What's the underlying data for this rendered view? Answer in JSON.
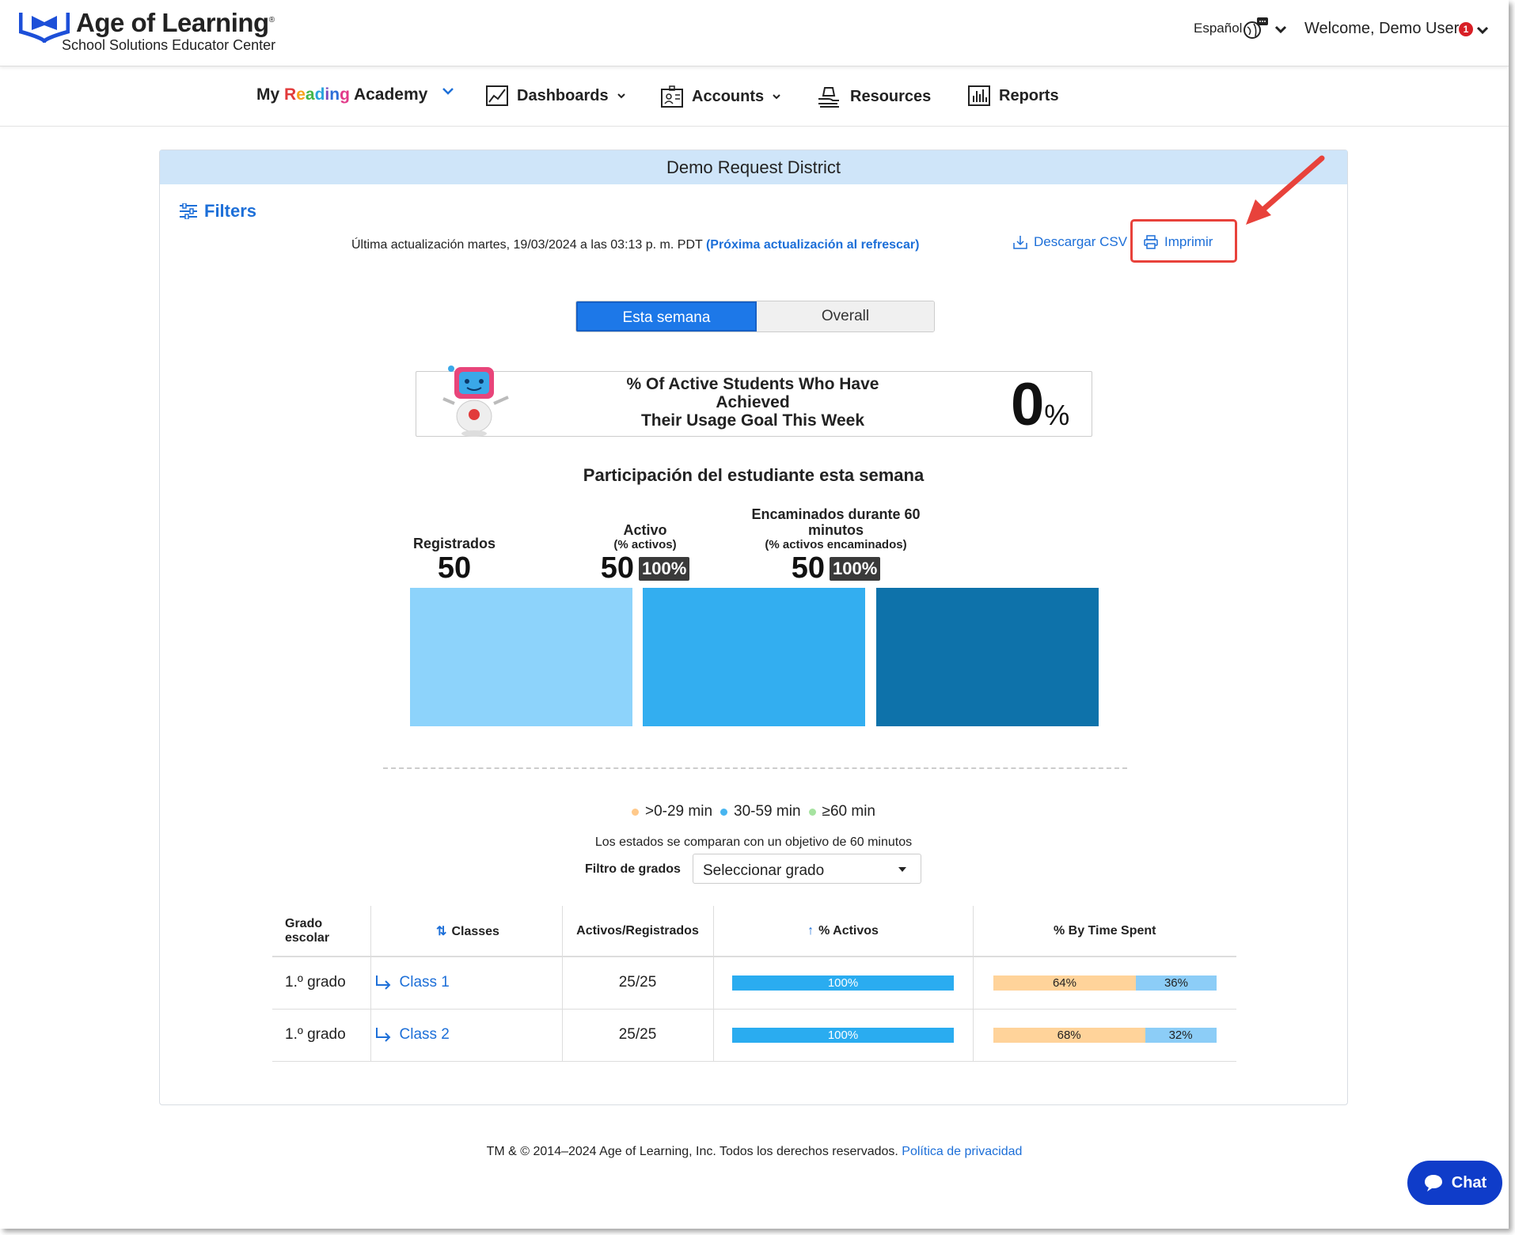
{
  "header": {
    "brand": "Age of Learning",
    "subbrand": "School Solutions Educator Center",
    "language": "Español",
    "welcome": "Welcome, Demo User",
    "notification_count": "1"
  },
  "nav": {
    "product": [
      "My ",
      "R",
      "e",
      "a",
      "d",
      "i",
      "n",
      "g",
      " Academy"
    ],
    "items": [
      {
        "label": "Dashboards",
        "icon": "chart-icon"
      },
      {
        "label": "Accounts",
        "icon": "id-card-icon"
      },
      {
        "label": "Resources",
        "icon": "hand-book-icon"
      },
      {
        "label": "Reports",
        "icon": "bar-chart-icon"
      }
    ]
  },
  "card": {
    "title": "Demo Request District",
    "filters": "Filters",
    "updated": "Última actualización martes, 19/03/2024 a las 03:13 p. m. PDT ",
    "updated_link": "(Próxima actualización al refrescar)",
    "download_csv": "Descargar CSV",
    "print": "Imprimir",
    "tabs": {
      "active": "Esta semana",
      "inactive": "Overall"
    },
    "goal": {
      "text_line1": "% Of Active Students Who Have",
      "text_line2": "Achieved",
      "text_line3": "Their Usage Goal This Week",
      "value": "0",
      "unit": "%"
    },
    "participation": {
      "title": "Participación del estudiante esta semana",
      "columns": [
        {
          "title": "Registrados",
          "subtitle": "",
          "value": "50",
          "badge": ""
        },
        {
          "title": "Activo",
          "subtitle": "(% activos)",
          "value": "50",
          "badge": "100%"
        },
        {
          "title": "Encaminados durante 60 minutos",
          "subtitle": "(% activos encaminados)",
          "value": "50",
          "badge": "100%"
        }
      ],
      "colors": [
        "#8dd3fb",
        "#33aef0",
        "#0e72aa"
      ]
    },
    "legend": [
      {
        "label": ">0-29 min",
        "color": "#ffc98a"
      },
      {
        "label": "30-59 min",
        "color": "#47b5f0"
      },
      {
        "label": "≥60 min",
        "color": "#a6e3a0"
      }
    ],
    "compare_note": "Los estados se comparan con un objetivo de 60 minutos",
    "grade_filter": {
      "label": "Filtro de grados",
      "value": "Seleccionar grado"
    },
    "table": {
      "headers": [
        "Grado escolar",
        "Classes",
        "Activos/Registrados",
        "% Activos",
        "% By Time Spent"
      ],
      "rows": [
        {
          "grade": "1.º grado",
          "class": "Class 1",
          "ratio": "25/25",
          "active": "100%",
          "active_frac": 1.0,
          "time": [
            "64%",
            "36%"
          ],
          "time_frac": [
            0.64,
            0.36
          ]
        },
        {
          "grade": "1.º grado",
          "class": "Class 2",
          "ratio": "25/25",
          "active": "100%",
          "active_frac": 1.0,
          "time": [
            "68%",
            "32%"
          ],
          "time_frac": [
            0.68,
            0.32
          ]
        }
      ]
    }
  },
  "footer": {
    "text": "TM & © 2014–2024 Age of Learning, Inc. Todos los derechos reservados. ",
    "privacy": "Política de privacidad"
  },
  "chat": {
    "label": "Chat"
  }
}
